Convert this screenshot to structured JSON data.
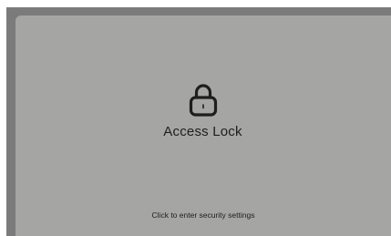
{
  "lock_screen": {
    "icon": "lock-icon",
    "title": "Access Lock",
    "hint": "Click to enter security settings"
  },
  "colors": {
    "frame": "#7b7b7b",
    "panel": "#a5a5a4",
    "text": "#1e1e1e"
  }
}
